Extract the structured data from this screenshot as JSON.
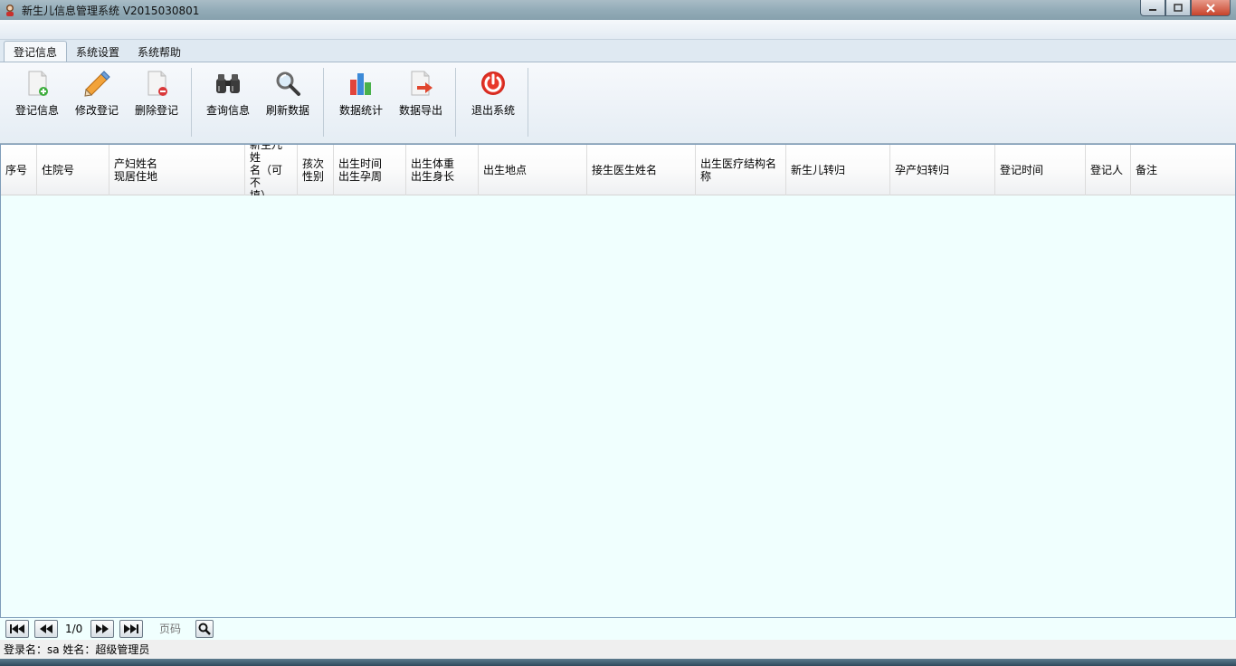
{
  "window": {
    "title": "新生儿信息管理系统 V2015030801"
  },
  "tabs": [
    {
      "label": "登记信息",
      "active": true
    },
    {
      "label": "系统设置",
      "active": false
    },
    {
      "label": "系统帮助",
      "active": false
    }
  ],
  "ribbon": {
    "register": "登记信息",
    "edit": "修改登记",
    "delete": "删除登记",
    "query": "查询信息",
    "refresh": "刷新数据",
    "stats": "数据统计",
    "export": "数据导出",
    "exit": "退出系统"
  },
  "grid": {
    "columns": [
      "序号",
      "住院号",
      "产妇姓名\n现居住地",
      "新生儿姓\n名（可不\n填）",
      "孩次\n性别",
      "出生时间\n出生孕周",
      "出生体重\n出生身长",
      "出生地点",
      "接生医生姓名",
      "出生医疗结构名\n称",
      "新生儿转归",
      "孕产妇转归",
      "登记时间",
      "登记人",
      "备注"
    ]
  },
  "pager": {
    "page_info": "1/0",
    "page_placeholder": "页码"
  },
  "status": {
    "text": "登录名：sa  姓名：超级管理员"
  }
}
